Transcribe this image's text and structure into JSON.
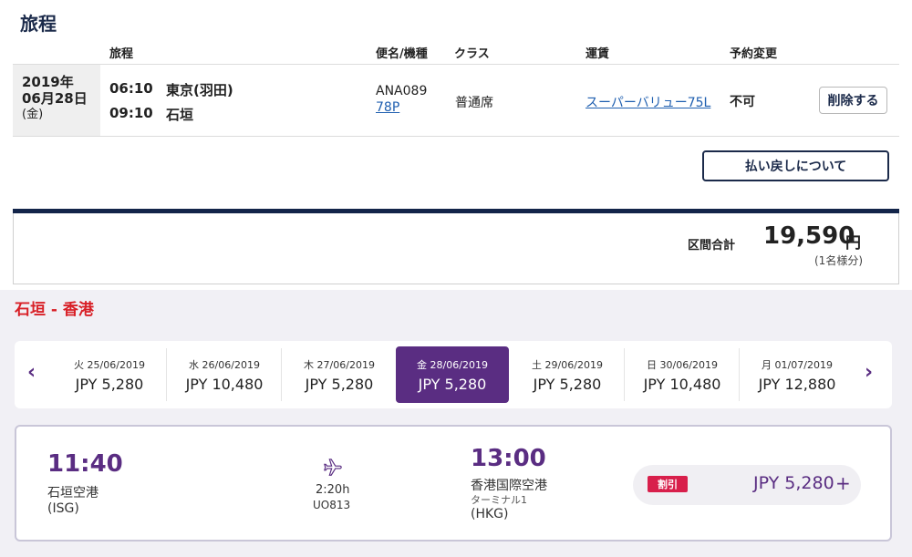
{
  "itinerary": {
    "title": "旅程",
    "headers": {
      "route": "旅程",
      "flight": "便名/機種",
      "class": "クラス",
      "fare": "運賃",
      "change": "予約変更"
    },
    "row": {
      "year": "2019年",
      "month_day": "06月28日",
      "weekday": "(金)",
      "dep_time": "06:10",
      "dep_city": "東京(羽田)",
      "arr_time": "09:10",
      "arr_city": "石垣",
      "flight_no": "ANA089",
      "aircraft": "78P",
      "class": "普通席",
      "fare_name": "スーパーバリュー75L",
      "change": "不可",
      "delete_label": "削除する"
    },
    "refund_label": "払い戻しについて"
  },
  "total": {
    "label": "区間合計",
    "amount": "19,590",
    "unit": "円",
    "note": "(1名様分)"
  },
  "flight_search": {
    "route_title": "石垣 - 香港",
    "prev_arrow": "‹",
    "next_arrow": "›",
    "dates": [
      {
        "label": "火 25/06/2019",
        "price": "JPY 5,280"
      },
      {
        "label": "水 26/06/2019",
        "price": "JPY 10,480"
      },
      {
        "label": "木 27/06/2019",
        "price": "JPY 5,280"
      },
      {
        "label": "金 28/06/2019",
        "price": "JPY 5,280"
      },
      {
        "label": "土 29/06/2019",
        "price": "JPY 5,280"
      },
      {
        "label": "日 30/06/2019",
        "price": "JPY 10,480"
      },
      {
        "label": "月 01/07/2019",
        "price": "JPY 12,880"
      }
    ],
    "flight": {
      "dep_time": "11:40",
      "dep_airport": "石垣空港",
      "dep_code": "(ISG)",
      "duration": "2:20h",
      "flight_no": "UO813",
      "arr_time": "13:00",
      "arr_airport": "香港国際空港",
      "terminal": "ターミナル1",
      "arr_code": "(HKG)",
      "badge": "割引",
      "price": "JPY 5,280",
      "plus": "+"
    },
    "colors": {
      "accent_purple": "#5a2d82",
      "route_red": "#d81f26",
      "badge_red": "#d81f4b",
      "navy": "#13254a"
    }
  }
}
